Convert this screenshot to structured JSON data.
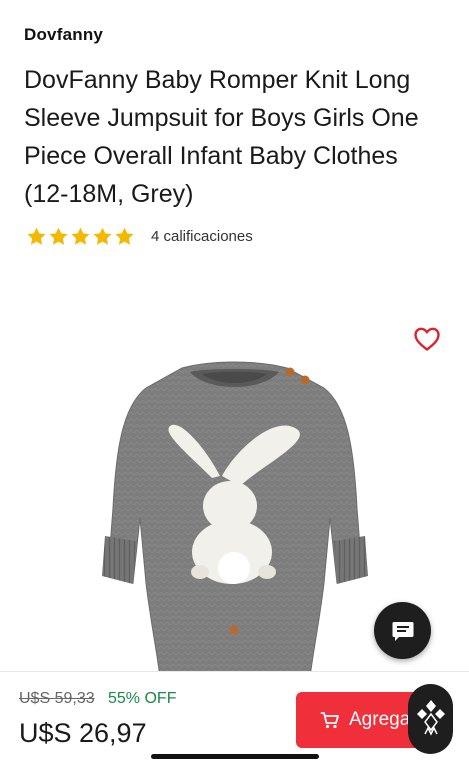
{
  "brand": "Dovfanny",
  "product": {
    "title": "DovFanny Baby Romper Knit Long Sleeve Jumpsuit for Boys Girls One Piece Overall Infant Baby Clothes (12-18M, Grey)",
    "rating": {
      "stars": 5,
      "count_label": "4 calificaciones"
    },
    "image_alt": "Grey knit baby romper with white bunny",
    "favorite_icon": "heart-outline-icon"
  },
  "pricing": {
    "old_price": "U$S 59,33",
    "discount": "55% OFF",
    "price": "U$S 26,97"
  },
  "actions": {
    "add_to_cart_label": "Agregar al carrito",
    "cart_icon": "cart-icon",
    "chat_icon": "chat-icon"
  },
  "colors": {
    "accent": "#ef2f3a",
    "discount": "#1a8a4a",
    "star": "#f5b800",
    "heart": "#d9252e"
  }
}
